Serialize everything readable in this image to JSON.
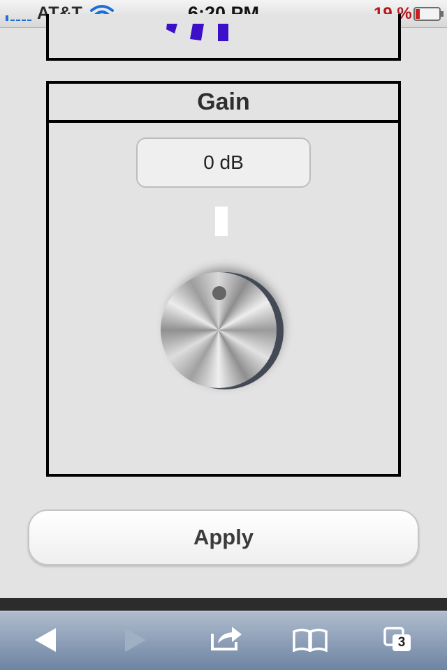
{
  "status_bar": {
    "carrier": "AT&T",
    "time": "6:20 PM",
    "battery_percent": "19 %",
    "battery_level": 0.19,
    "icons": [
      "signal-bars-icon",
      "wifi-icon",
      "battery-icon"
    ]
  },
  "gain_panel": {
    "title": "Gain",
    "value": "0 dB"
  },
  "apply_button": {
    "label": "Apply"
  },
  "toolbar": {
    "tab_count": "3",
    "icons": [
      "back-arrow-icon",
      "forward-arrow-icon",
      "share-icon",
      "bookmarks-icon",
      "tabs-icon"
    ]
  },
  "colors": {
    "background": "#e3e3e3",
    "toolbar": "#8597b2",
    "battery_text": "#b8141a",
    "chart_bar": "#3b10c8"
  }
}
